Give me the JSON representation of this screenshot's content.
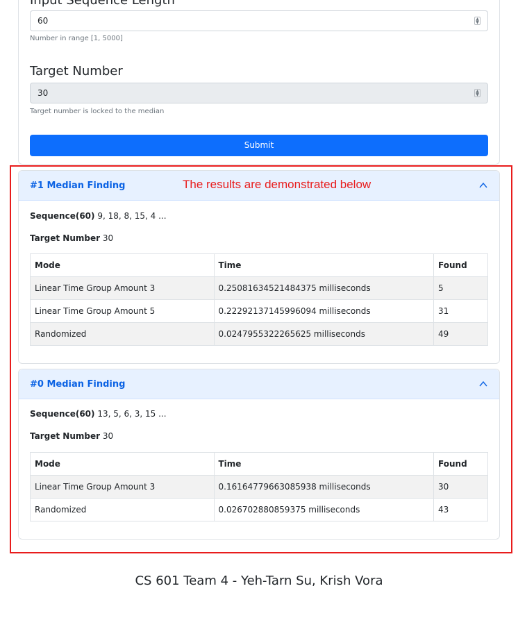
{
  "form": {
    "seq_label": "Input Sequence Length",
    "seq_value": "60",
    "seq_help": "Number in range [1, 5000]",
    "target_label": "Target Number",
    "target_value": "30",
    "target_help": "Target number is locked to the median",
    "submit_label": "Submit"
  },
  "annotation": {
    "text": "The results are demonstrated below",
    "color": "#e81c1c"
  },
  "results": [
    {
      "title": "#1 Median Finding",
      "sequence_label": "Sequence(60)",
      "sequence_value": "9, 18, 8, 15, 4 ...",
      "target_label": "Target Number",
      "target_value": "30",
      "headers": [
        "Mode",
        "Time",
        "Found"
      ],
      "rows": [
        [
          "Linear Time Group Amount 3",
          "0.25081634521484375 milliseconds",
          "5"
        ],
        [
          "Linear Time Group Amount 5",
          "0.22292137145996094 milliseconds",
          "31"
        ],
        [
          "Randomized",
          "0.0247955322265625 milliseconds",
          "49"
        ]
      ]
    },
    {
      "title": "#0 Median Finding",
      "sequence_label": "Sequence(60)",
      "sequence_value": "13, 5, 6, 3, 15 ...",
      "target_label": "Target Number",
      "target_value": "30",
      "headers": [
        "Mode",
        "Time",
        "Found"
      ],
      "rows": [
        [
          "Linear Time Group Amount 3",
          "0.16164779663085938 milliseconds",
          "30"
        ],
        [
          "Randomized",
          "0.026702880859375 milliseconds",
          "43"
        ]
      ]
    }
  ],
  "footer": "CS 601 Team 4 - Yeh-Tarn Su, Krish Vora",
  "colors": {
    "accent": "#0d6efd",
    "accordion_header": "#e7f1ff",
    "accordion_title": "#0c63e4"
  }
}
